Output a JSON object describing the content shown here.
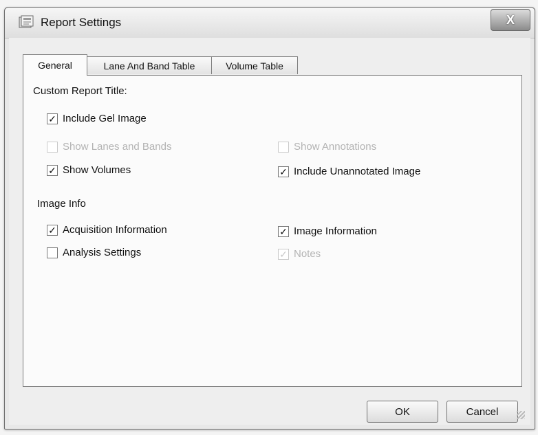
{
  "window": {
    "title": "Report Settings",
    "close_label": "X"
  },
  "tabs": [
    {
      "label": "General",
      "active": true
    },
    {
      "label": "Lane And Band Table",
      "active": false
    },
    {
      "label": "Volume Table",
      "active": false
    }
  ],
  "general": {
    "custom_title_label": "Custom Report Title:",
    "include_gel_image": {
      "label": "Include Gel Image",
      "checked": true,
      "enabled": true
    },
    "show_lanes_bands": {
      "label": "Show Lanes and Bands",
      "checked": false,
      "enabled": false
    },
    "show_annotations": {
      "label": "Show Annotations",
      "checked": false,
      "enabled": false
    },
    "show_volumes": {
      "label": "Show Volumes",
      "checked": true,
      "enabled": true
    },
    "include_unannotated": {
      "label": "Include Unannotated Image",
      "checked": true,
      "enabled": true
    },
    "image_info_label": "Image Info",
    "acquisition_info": {
      "label": "Acquisition Information",
      "checked": true,
      "enabled": true
    },
    "image_information": {
      "label": "Image Information",
      "checked": true,
      "enabled": true
    },
    "analysis_settings": {
      "label": "Analysis Settings",
      "checked": false,
      "enabled": true
    },
    "notes": {
      "label": "Notes",
      "checked": true,
      "enabled": false
    }
  },
  "buttons": {
    "ok": "OK",
    "cancel": "Cancel"
  },
  "check_mark": "✓"
}
